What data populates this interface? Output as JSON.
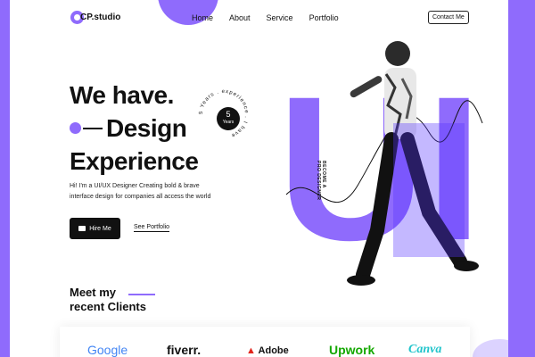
{
  "header": {
    "logo_text": "CP.studio",
    "nav": [
      "Home",
      "About",
      "Service",
      "Portfolio"
    ],
    "contact_label": "Contact Me"
  },
  "hero": {
    "line1": "We have.",
    "line2": "Design",
    "line3": "Experience",
    "badge": {
      "number": "5",
      "unit": "Years",
      "ring_text": "5 Years . experience . I have"
    },
    "intro_line1": "Hi! I'm  a UI/UX Designer Creating bold & brave",
    "intro_line2": "interface design for companies all access the world",
    "hire_label": "Hire Me",
    "portfolio_link": "See Portfolio",
    "vertical_tag_line1": "BECOME A",
    "vertical_tag_line2": "PRO DESIGNER",
    "big_letters": "UI"
  },
  "clients": {
    "title_line1": "Meet my",
    "title_line2": "recent Clients",
    "brands": [
      "Google",
      "fiverr.",
      "Adobe",
      "Upwork",
      "Canva"
    ]
  },
  "colors": {
    "accent": "#8f6bfc",
    "dark": "#111111",
    "background": "#ffffff"
  }
}
